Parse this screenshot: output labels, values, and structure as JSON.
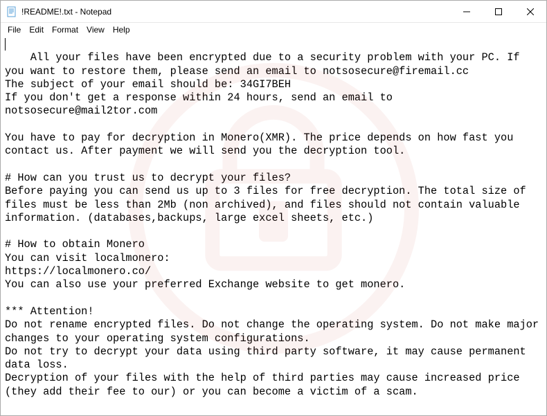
{
  "window": {
    "title": "!README!.txt - Notepad"
  },
  "menu": {
    "file": "File",
    "edit": "Edit",
    "format": "Format",
    "view": "View",
    "help": "Help"
  },
  "document": {
    "body": "All your files have been encrypted due to a security problem with your PC. If you want to restore them, please send an email to notsosecure@firemail.cc\nThe subject of your email should be: 34GI7BEH\nIf you don't get a response within 24 hours, send an email to notsosecure@mail2tor.com\n\nYou have to pay for decryption in Monero(XMR). The price depends on how fast you contact us. After payment we will send you the decryption tool.\n\n# How can you trust us to decrypt your files?\nBefore paying you can send us up to 3 files for free decryption. The total size of files must be less than 2Mb (non archived), and files should not contain valuable information. (databases,backups, large excel sheets, etc.)\n\n# How to obtain Monero\nYou can visit localmonero:\nhttps://localmonero.co/\nYou can also use your preferred Exchange website to get monero.\n\n*** Attention!\nDo not rename encrypted files. Do not change the operating system. Do not make major changes to your operating system configurations.\nDo not try to decrypt your data using third party software, it may cause permanent data loss.\nDecryption of your files with the help of third parties may cause increased price (they add their fee to our) or you can become a victim of a scam."
  }
}
